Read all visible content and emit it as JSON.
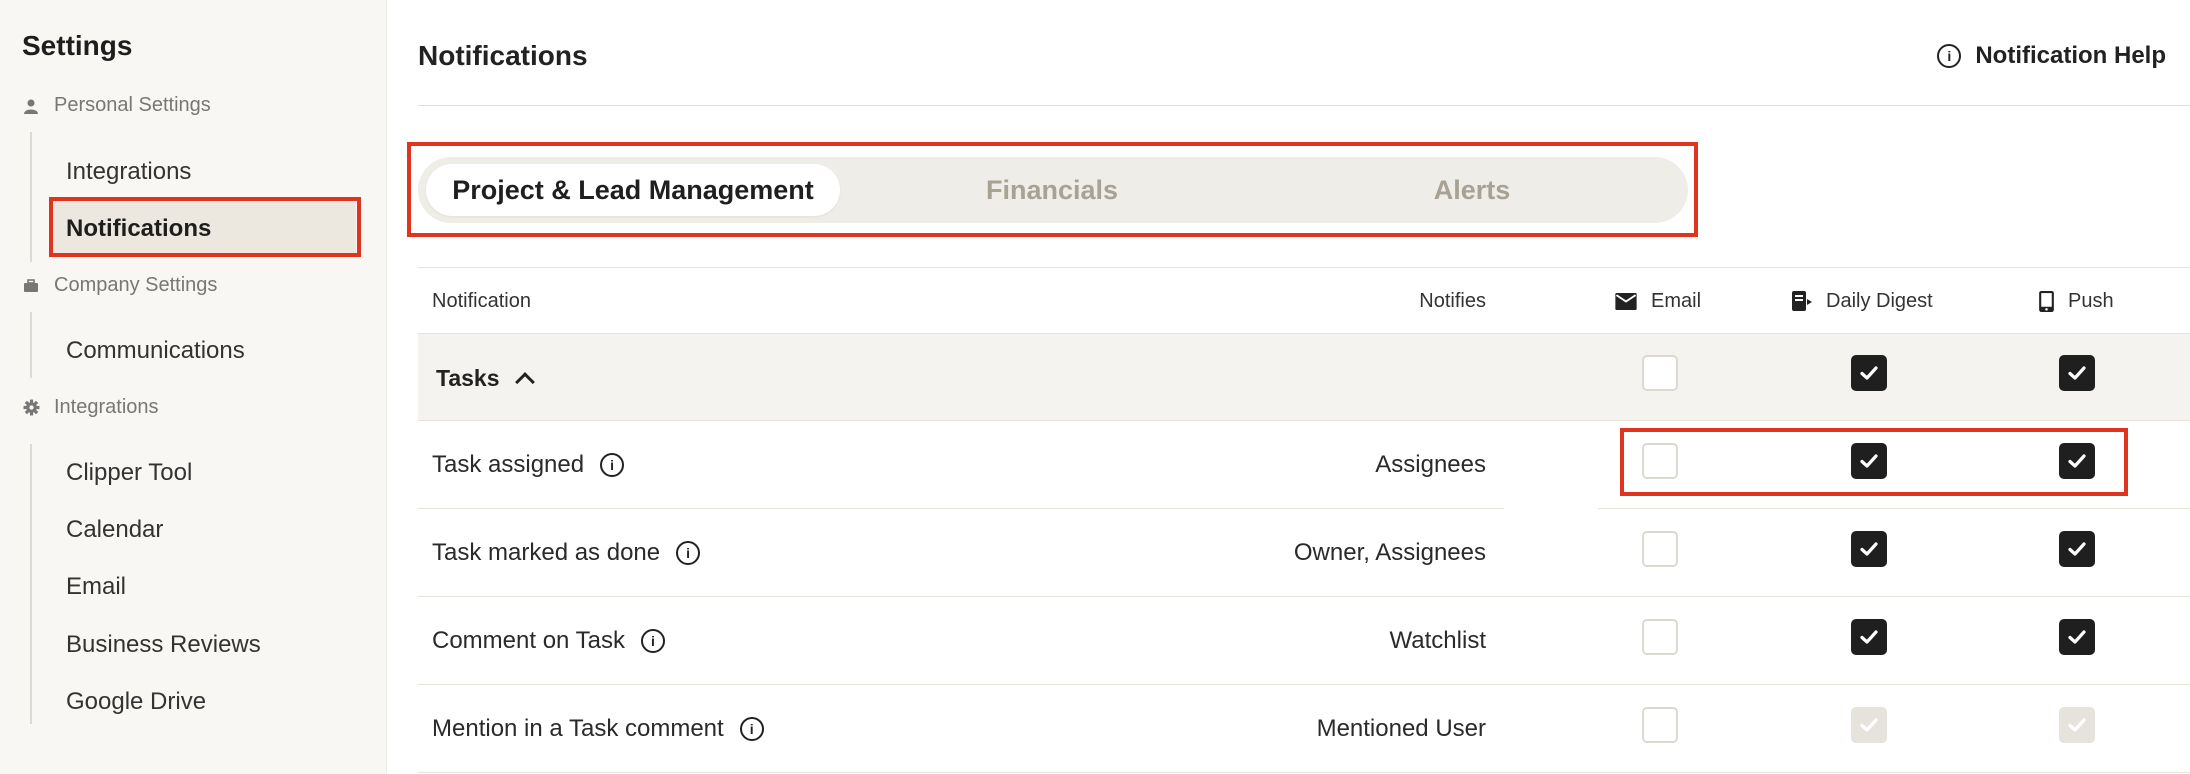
{
  "sidebar": {
    "title": "Settings",
    "sections": [
      {
        "label": "Personal Settings",
        "icon": "person-icon"
      },
      {
        "label": "Company Settings",
        "icon": "briefcase-icon"
      },
      {
        "label": "Integrations",
        "icon": "gear-icon"
      }
    ],
    "items": [
      {
        "label": "Integrations"
      },
      {
        "label": "Notifications"
      },
      {
        "label": "Communications"
      },
      {
        "label": "Clipper Tool"
      },
      {
        "label": "Calendar"
      },
      {
        "label": "Email"
      },
      {
        "label": "Business Reviews"
      },
      {
        "label": "Google Drive"
      }
    ]
  },
  "header": {
    "title": "Notifications",
    "help_label": "Notification Help",
    "help_icon": "info-icon"
  },
  "tabs": [
    {
      "label": "Project & Lead Management",
      "active": true
    },
    {
      "label": "Financials",
      "active": false
    },
    {
      "label": "Alerts",
      "active": false
    }
  ],
  "table": {
    "columns": {
      "notification": "Notification",
      "notifies": "Notifies",
      "email": "Email",
      "digest": "Daily Digest",
      "push": "Push"
    },
    "group": {
      "label": "Tasks",
      "email": false,
      "digest": true,
      "push": true
    },
    "rows": [
      {
        "label": "Task assigned",
        "notifies": "Assignees",
        "email": "off",
        "digest": "on",
        "push": "on"
      },
      {
        "label": "Task marked as done",
        "notifies": "Owner, Assignees",
        "email": "off",
        "digest": "on",
        "push": "on"
      },
      {
        "label": "Comment on Task",
        "notifies": "Watchlist",
        "email": "off",
        "digest": "on",
        "push": "on"
      },
      {
        "label": "Mention in a Task comment",
        "notifies": "Mentioned User",
        "email": "off",
        "digest": "disabled",
        "push": "disabled"
      }
    ]
  },
  "colors": {
    "highlight": "#e0341e",
    "checkbox_on": "#1f1f1f",
    "checkbox_disabled": "#e6e3dc"
  }
}
